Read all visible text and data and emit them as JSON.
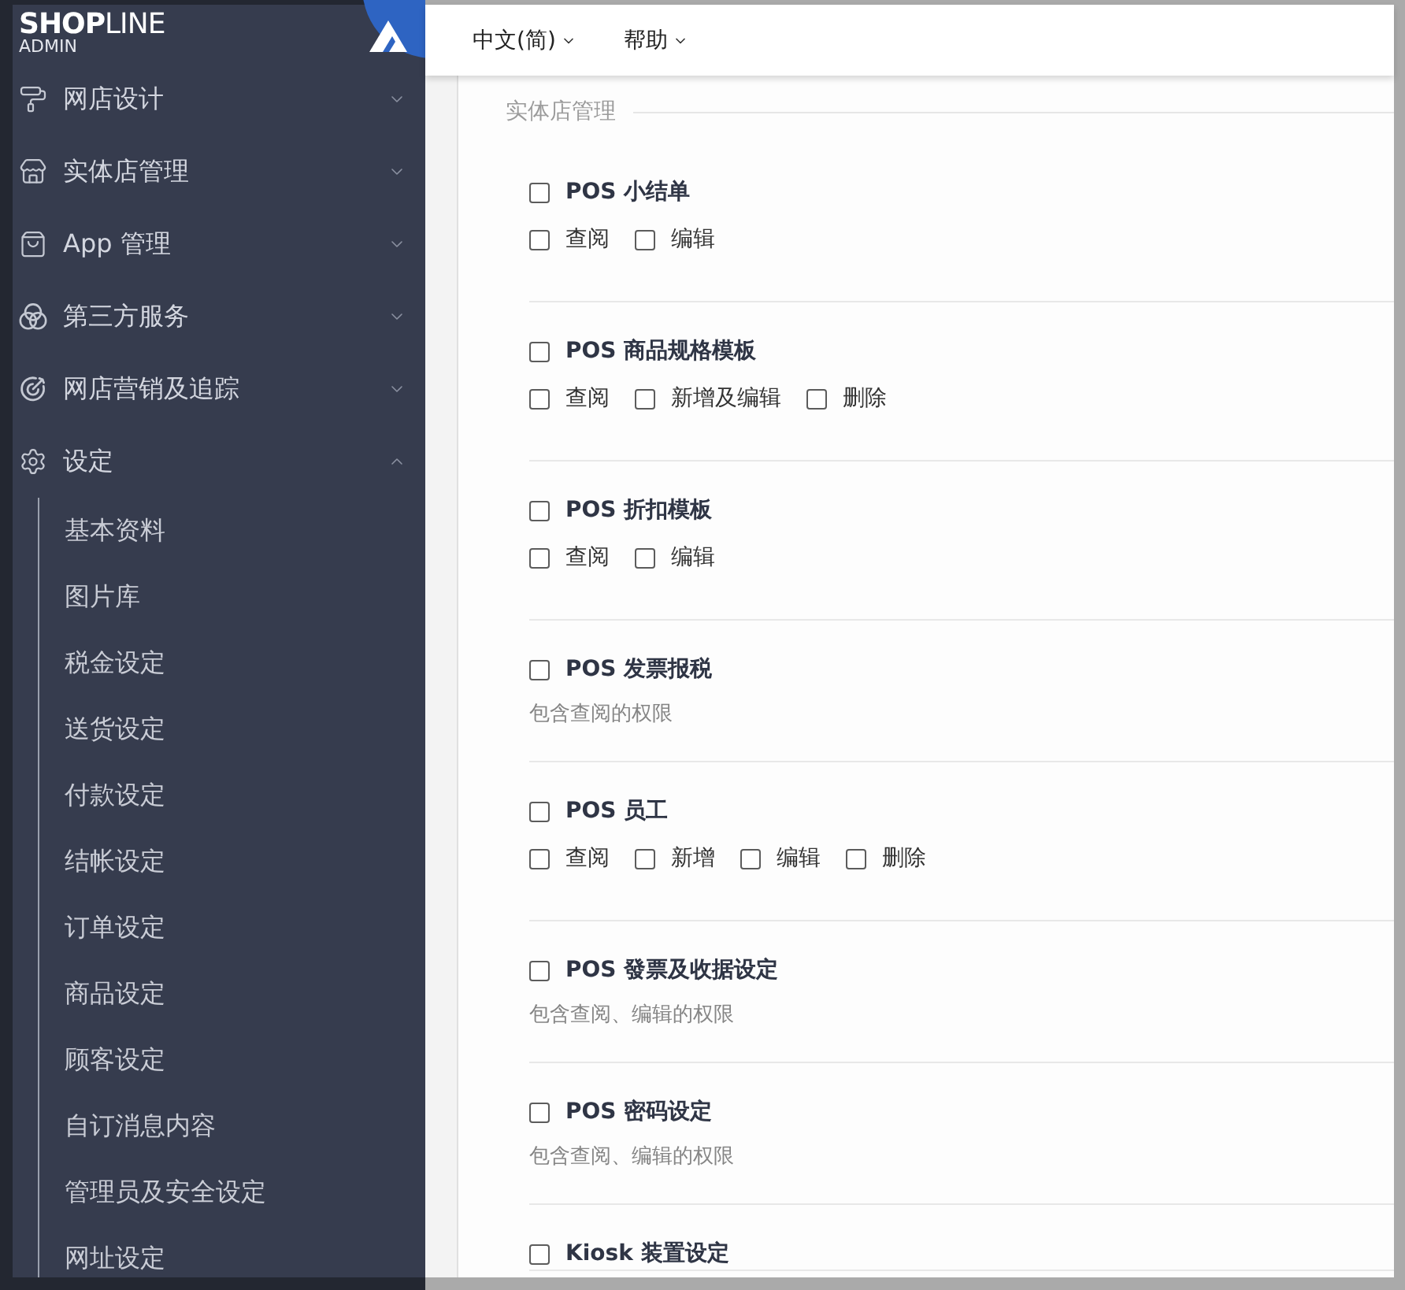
{
  "sidebar": {
    "logo": {
      "brand": "**SHOP**LINE",
      "subtitle": "ADMIN"
    },
    "items": [
      {
        "label": "网店设计",
        "expanded": false
      },
      {
        "label": "实体店管理",
        "expanded": false
      },
      {
        "label": "App 管理",
        "expanded": false
      },
      {
        "label": "第三方服务",
        "expanded": false
      },
      {
        "label": "网店营销及追踪",
        "expanded": false
      },
      {
        "label": "设定",
        "expanded": true,
        "children": [
          {
            "label": "基本资料",
            "selected": false
          },
          {
            "label": "图片库",
            "selected": false
          },
          {
            "label": "税金设定",
            "selected": false
          },
          {
            "label": "送货设定",
            "selected": false
          },
          {
            "label": "付款设定",
            "selected": false
          },
          {
            "label": "结帐设定",
            "selected": false
          },
          {
            "label": "订单设定",
            "selected": false
          },
          {
            "label": "商品设定",
            "selected": false
          },
          {
            "label": "顾客设定",
            "selected": false
          },
          {
            "label": "自订消息内容",
            "selected": false
          },
          {
            "label": "管理员及安全设定",
            "selected": false
          },
          {
            "label": "网址设定",
            "selected": false
          }
        ]
      }
    ]
  },
  "header": {
    "menus": [
      {
        "label": "中文(简)"
      },
      {
        "label": "帮助"
      }
    ]
  },
  "section": {
    "title": "实体店管理",
    "permissions": [
      {
        "kind": "options",
        "label": "POS 小结单",
        "checked": false,
        "options": [
          {
            "label": "查阅",
            "checked": false
          },
          {
            "label": "编辑",
            "checked": false
          }
        ]
      },
      {
        "kind": "options",
        "label": "POS 商品规格模板",
        "checked": false,
        "options": [
          {
            "label": "查阅",
            "checked": false
          },
          {
            "label": "新增及编辑",
            "checked": false
          },
          {
            "label": "删除",
            "checked": false
          }
        ]
      },
      {
        "kind": "options",
        "label": "POS 折扣模板",
        "checked": false,
        "options": [
          {
            "label": "查阅",
            "checked": false
          },
          {
            "label": "编辑",
            "checked": false
          }
        ]
      },
      {
        "kind": "note",
        "label": "POS 发票报税",
        "checked": false,
        "note": "包含查阅的权限"
      },
      {
        "kind": "options",
        "label": "POS 员工",
        "checked": false,
        "options": [
          {
            "label": "查阅",
            "checked": false
          },
          {
            "label": "新增",
            "checked": false
          },
          {
            "label": "编辑",
            "checked": false
          },
          {
            "label": "删除",
            "checked": false
          }
        ]
      },
      {
        "kind": "note",
        "label": "POS 發票及收据设定",
        "checked": false,
        "note": "包含查阅、编辑的权限"
      },
      {
        "kind": "note",
        "label": "POS 密码设定",
        "checked": false,
        "note": "包含查阅、编辑的权限"
      },
      {
        "kind": "title",
        "label": "Kiosk 装置设定",
        "checked": false
      }
    ]
  }
}
